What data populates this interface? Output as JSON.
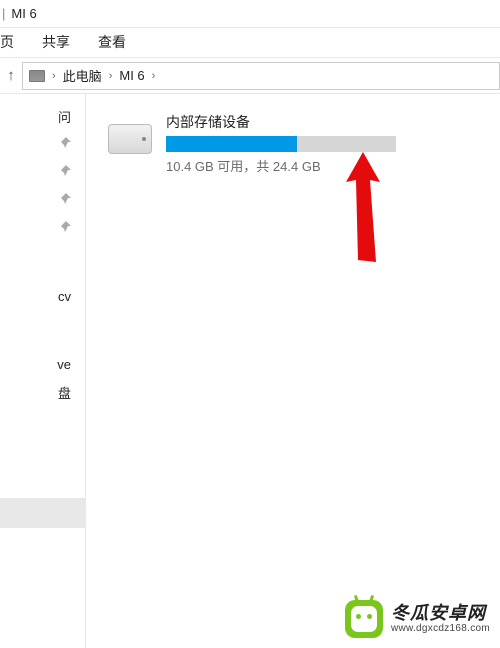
{
  "window": {
    "separator": "|",
    "title": "MI 6"
  },
  "menu": {
    "items": [
      "页",
      "共享",
      "查看"
    ]
  },
  "breadcrumb": {
    "up_glyph": "↑",
    "sep_glyph": "›",
    "segments": [
      "此电脑",
      "MI 6"
    ]
  },
  "sidebar": {
    "top_label": "问",
    "pin_glyph": "📌",
    "rows": [
      "",
      "",
      "",
      ""
    ],
    "labels": [
      "cv",
      "ve",
      "盘"
    ]
  },
  "drive": {
    "name": "内部存储设备",
    "free_gb": 10.4,
    "total_gb": 24.4,
    "status_text": "10.4 GB 可用，共 24.4 GB",
    "used_percent": 57
  },
  "watermark": {
    "name_cn": "冬瓜安卓网",
    "url": "www.dgxcdz168.com"
  }
}
